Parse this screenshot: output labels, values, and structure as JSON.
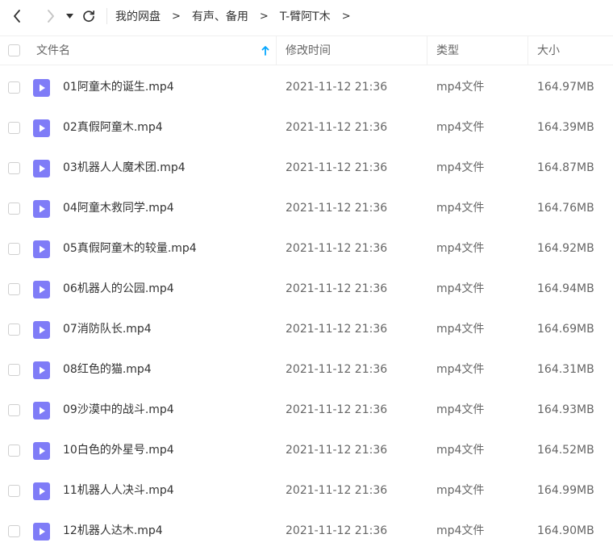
{
  "breadcrumb": {
    "items": [
      "我的网盘",
      "有声、备用",
      "T-臂阿T木"
    ],
    "separator": ">"
  },
  "columns": {
    "name": "文件名",
    "modified": "修改时间",
    "type": "类型",
    "size": "大小"
  },
  "sort": {
    "column": "name",
    "direction": "ascending"
  },
  "colors": {
    "accent": "#06a7ff",
    "file_icon": "#7f7cf7"
  },
  "files": [
    {
      "name": "01阿童木的诞生.mp4",
      "modified": "2021-11-12 21:36",
      "type": "mp4文件",
      "size": "164.97MB"
    },
    {
      "name": "02真假阿童木.mp4",
      "modified": "2021-11-12 21:36",
      "type": "mp4文件",
      "size": "164.39MB"
    },
    {
      "name": "03机器人人魔术团.mp4",
      "modified": "2021-11-12 21:36",
      "type": "mp4文件",
      "size": "164.87MB"
    },
    {
      "name": "04阿童木救同学.mp4",
      "modified": "2021-11-12 21:36",
      "type": "mp4文件",
      "size": "164.76MB"
    },
    {
      "name": "05真假阿童木的较量.mp4",
      "modified": "2021-11-12 21:36",
      "type": "mp4文件",
      "size": "164.92MB"
    },
    {
      "name": "06机器人的公园.mp4",
      "modified": "2021-11-12 21:36",
      "type": "mp4文件",
      "size": "164.94MB"
    },
    {
      "name": "07消防队长.mp4",
      "modified": "2021-11-12 21:36",
      "type": "mp4文件",
      "size": "164.69MB"
    },
    {
      "name": "08红色的猫.mp4",
      "modified": "2021-11-12 21:36",
      "type": "mp4文件",
      "size": "164.31MB"
    },
    {
      "name": "09沙漠中的战斗.mp4",
      "modified": "2021-11-12 21:36",
      "type": "mp4文件",
      "size": "164.93MB"
    },
    {
      "name": "10白色的外星号.mp4",
      "modified": "2021-11-12 21:36",
      "type": "mp4文件",
      "size": "164.52MB"
    },
    {
      "name": "11机器人人决斗.mp4",
      "modified": "2021-11-12 21:36",
      "type": "mp4文件",
      "size": "164.99MB"
    },
    {
      "name": "12机器人达木.mp4",
      "modified": "2021-11-12 21:36",
      "type": "mp4文件",
      "size": "164.90MB"
    }
  ]
}
